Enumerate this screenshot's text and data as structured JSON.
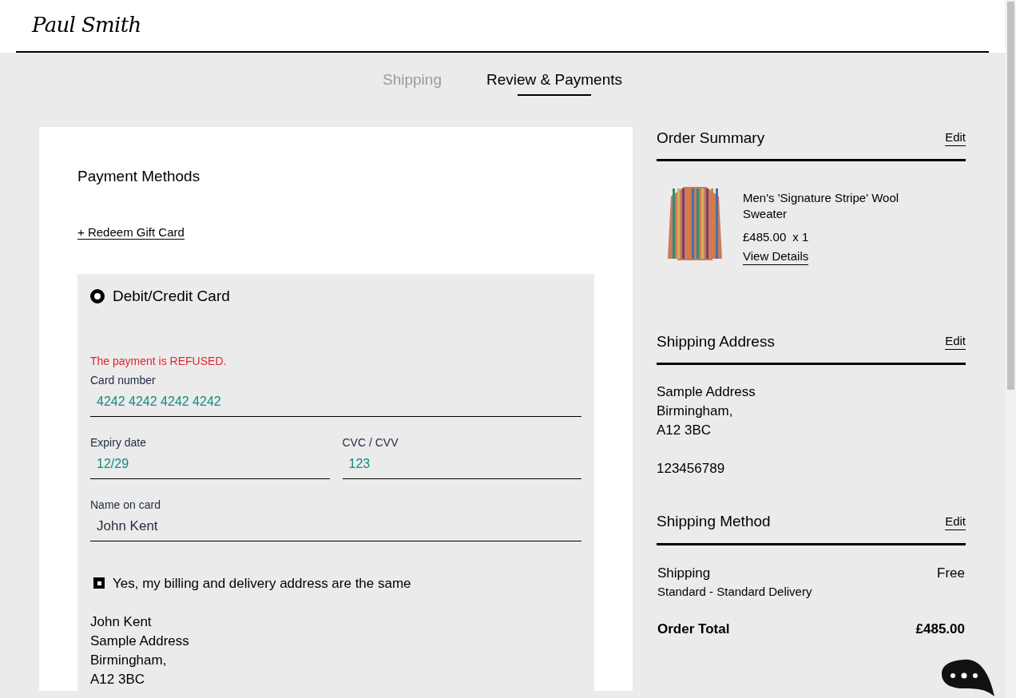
{
  "header": {
    "logo": "Paul Smith"
  },
  "steps": [
    {
      "label": "Shipping",
      "selected": false
    },
    {
      "label": "Review & Payments",
      "selected": true
    }
  ],
  "payment": {
    "title": "Payment Methods",
    "gift_card_link": "+ Redeem Gift Card",
    "method": {
      "label": "Debit/Credit Card",
      "selected": true
    },
    "error": "The payment is REFUSED.",
    "card_number": {
      "label": "Card number",
      "value": "4242 4242 4242 4242"
    },
    "expiry": {
      "label": "Expiry date",
      "value": "12/29"
    },
    "cvc": {
      "label": "CVC / CVV",
      "value": "123"
    },
    "name": {
      "label": "Name on card",
      "value": "John Kent"
    },
    "same_address": {
      "label": "Yes, my billing and delivery address are the same",
      "checked": true
    },
    "billing_address": [
      "John Kent",
      "Sample Address",
      "Birmingham,",
      "A12 3BC"
    ]
  },
  "summary": {
    "title": "Order Summary",
    "edit": "Edit",
    "item": {
      "name": "Men's 'Signature Stripe' Wool Sweater",
      "price": "£485.00",
      "quantity": "x 1",
      "details_link": "View Details"
    }
  },
  "shipping_address": {
    "title": "Shipping Address",
    "edit": "Edit",
    "lines": [
      "Sample Address",
      "Birmingham,",
      "A12 3BC"
    ],
    "phone": "123456789"
  },
  "shipping_method": {
    "title": "Shipping Method",
    "edit": "Edit",
    "label": "Shipping",
    "value": "Free",
    "description": "Standard - Standard Delivery"
  },
  "total": {
    "label": "Order Total",
    "value": "£485.00"
  }
}
